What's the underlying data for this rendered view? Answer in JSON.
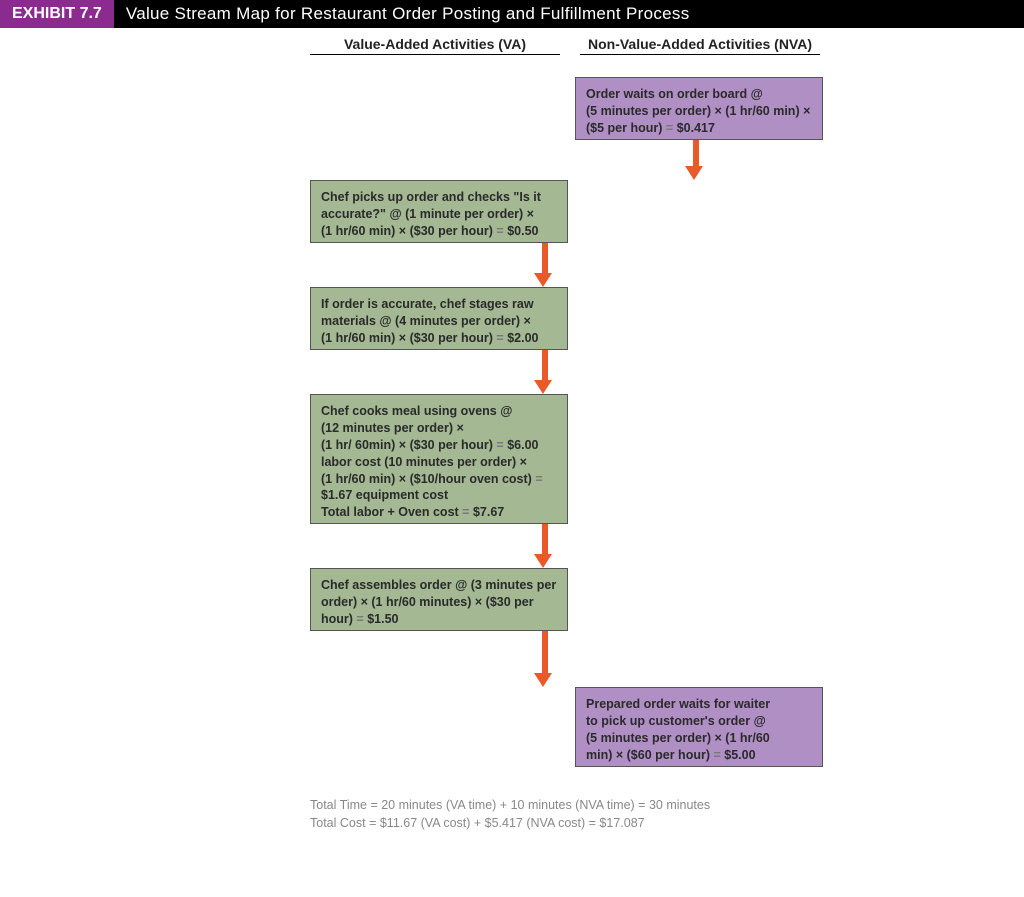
{
  "header": {
    "exhibit_tag": "EXHIBIT 7.7",
    "title": "Value Stream Map for Restaurant Order Posting and Fulfillment Process"
  },
  "columns": {
    "va_label": "Value-Added Activities (VA)",
    "nva_label": "Non-Value-Added Activities (NVA)"
  },
  "boxes": {
    "nva1": {
      "l1": "Order waits on order board @",
      "l2a": "(5  minutes per order)",
      "l2b": "(1 hr/60 min)",
      "l3a": "($5 per hour)",
      "l3b": "$0.417"
    },
    "va1": {
      "l1": "Chef picks up order and checks  \"Is it",
      "l2a": "accurate?\" @ (1 minute per order)",
      "l3a": "(1 hr/60 min)",
      "l3b": "($30 per hour)",
      "l3c": "$0.50"
    },
    "va2": {
      "l1": "If order is accurate, chef stages raw",
      "l2a": "materials @ (4 minutes per order)",
      "l3a": "(1 hr/60 min)",
      "l3b": "($30 per hour)",
      "l3c": "$2.00"
    },
    "va3": {
      "l1": "Chef cooks meal using ovens @",
      "l2": "(12 minutes per order)",
      "l3a": "(1 hr/ 60min)",
      "l3b": "($30 per hour)",
      "l3c": "$6.00",
      "l4a": "labor cost (10 minutes per order)",
      "l5a": "(1 hr/60 min)",
      "l5b": "($10/hour oven cost)",
      "l6": "$1.67 equipment cost",
      "l7a": "Total labor",
      "l7b": "Oven cost",
      "l7c": "$7.67"
    },
    "va4": {
      "l1a": "Chef assembles order @ (3 minutes per",
      "l2a": "order)",
      "l2b": "(1 hr/60 minutes)",
      "l2c": "($30 per",
      "l3a": "hour)",
      "l3b": "$1.50"
    },
    "nva2": {
      "l1": "Prepared order waits for waiter",
      "l2": "to pick up customer's order @",
      "l3a": "(5 minutes per order)",
      "l3b": "(1 hr/60",
      "l4a": "min)",
      "l4b": "($60 per hour)",
      "l4c": "$5.00"
    }
  },
  "totals": {
    "time_label": "Total Time",
    "time_va": "20 minutes (VA time)",
    "time_nva": "10 minutes (NVA time)",
    "time_total": "30 minutes",
    "cost_label": "Total Cost",
    "cost_va": "$11.67 (VA cost)",
    "cost_nva": "$5.417 (NVA cost)",
    "cost_total": "$17.087"
  },
  "chart_data": {
    "type": "diagram",
    "title": "Value Stream Map for Restaurant Order Posting and Fulfillment Process",
    "flow": [
      {
        "step": 1,
        "category": "NVA",
        "activity": "Order waits on order board",
        "minutes_per_order": 5,
        "rate_per_hour_usd": 5,
        "cost_usd": 0.417
      },
      {
        "step": 2,
        "category": "VA",
        "activity": "Chef picks up order and checks \"Is it accurate?\"",
        "minutes_per_order": 1,
        "rate_per_hour_usd": 30,
        "cost_usd": 0.5
      },
      {
        "step": 3,
        "category": "VA",
        "activity": "If order is accurate, chef stages raw materials",
        "minutes_per_order": 4,
        "rate_per_hour_usd": 30,
        "cost_usd": 2.0
      },
      {
        "step": 4,
        "category": "VA",
        "activity": "Chef cooks meal using ovens",
        "labor_minutes_per_order": 12,
        "labor_rate_per_hour_usd": 30,
        "labor_cost_usd": 6.0,
        "equipment_minutes_per_order": 10,
        "equipment_rate_per_hour_usd": 10,
        "equipment_cost_usd": 1.67,
        "total_cost_usd": 7.67
      },
      {
        "step": 5,
        "category": "VA",
        "activity": "Chef assembles order",
        "minutes_per_order": 3,
        "rate_per_hour_usd": 30,
        "cost_usd": 1.5
      },
      {
        "step": 6,
        "category": "NVA",
        "activity": "Prepared order waits for waiter to pick up customer's order",
        "minutes_per_order": 5,
        "rate_per_hour_usd": 60,
        "cost_usd": 5.0
      }
    ],
    "totals": {
      "va_time_min": 20,
      "nva_time_min": 10,
      "total_time_min": 30,
      "va_cost_usd": 11.67,
      "nva_cost_usd": 5.417,
      "total_cost_usd": 17.087
    }
  }
}
